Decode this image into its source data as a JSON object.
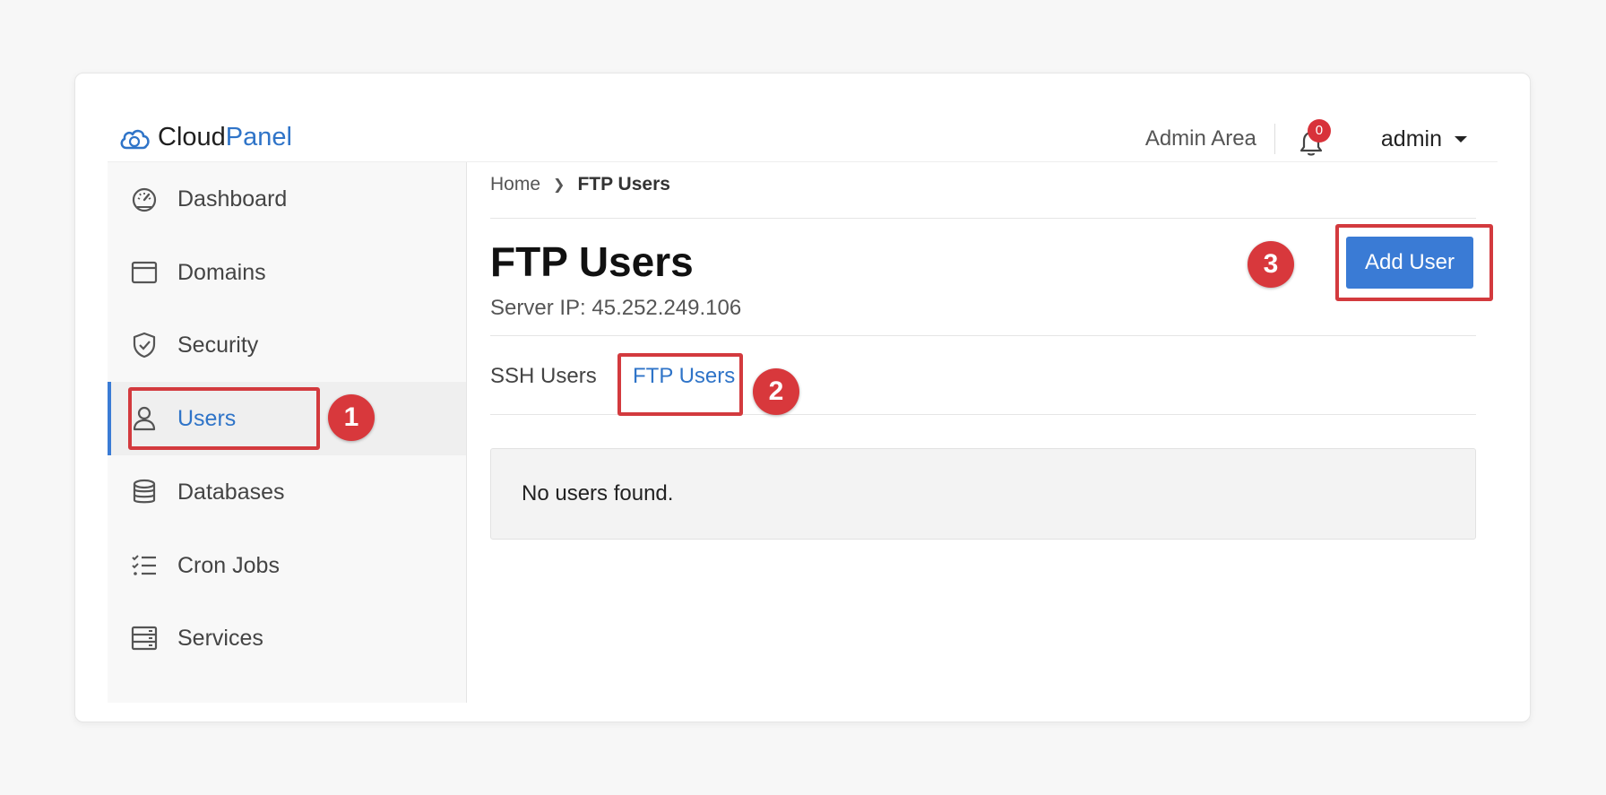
{
  "brand": {
    "part1": "Cloud",
    "part2": "Panel",
    "icon": "cloud-icon",
    "accent": "#2f74c8"
  },
  "header": {
    "admin_area": "Admin Area",
    "notifications": {
      "icon": "bell-icon",
      "count": "0"
    },
    "user": {
      "name": "admin",
      "icon": "caret-down-icon"
    }
  },
  "sidebar": {
    "items": [
      {
        "label": "Dashboard",
        "icon": "speedometer-icon"
      },
      {
        "label": "Domains",
        "icon": "browser-window-icon"
      },
      {
        "label": "Security",
        "icon": "shield-check-icon"
      },
      {
        "label": "Users",
        "icon": "user-icon",
        "active": true
      },
      {
        "label": "Databases",
        "icon": "database-icon"
      },
      {
        "label": "Cron Jobs",
        "icon": "checklist-icon"
      },
      {
        "label": "Services",
        "icon": "server-icon"
      }
    ]
  },
  "breadcrumb": {
    "home": "Home",
    "current": "FTP Users"
  },
  "page": {
    "title": "FTP Users",
    "server_ip": "Server IP: 45.252.249.106",
    "add_button": "Add User"
  },
  "tabs": [
    {
      "label": "SSH Users"
    },
    {
      "label": "FTP Users",
      "active": true
    }
  ],
  "empty_message": "No users found.",
  "annotations": [
    "1",
    "2",
    "3"
  ],
  "colors": {
    "primary": "#3a7bd5",
    "annotation": "#d33a3e",
    "badge": "#d8323a"
  }
}
